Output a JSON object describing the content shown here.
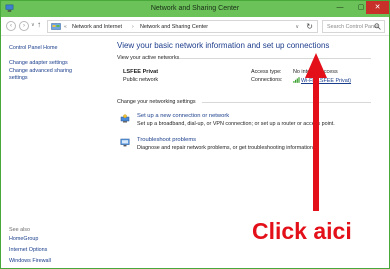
{
  "window": {
    "title": "Network and Sharing Center",
    "min_glyph": "—",
    "max_glyph": "▢",
    "close_glyph": "✕"
  },
  "address_bar": {
    "recent_glyph": "∨",
    "up_glyph": "↑",
    "path_sep0": "«",
    "crumbs": [
      "Network and Internet",
      "Network and Sharing Center"
    ],
    "crumb_sep": "›",
    "dropdown_glyph": "∨",
    "refresh_glyph": "↻",
    "search_placeholder": "Search Control Panel"
  },
  "sidebar": {
    "home": "Control Panel Home",
    "adapter": "Change adapter settings",
    "advanced": "Change advanced sharing settings",
    "see_also": "See also",
    "links": [
      "HomeGroup",
      "Internet Options",
      "Windows Firewall"
    ]
  },
  "main": {
    "heading": "View your basic network information and set up connections",
    "active_section": "View your active networks",
    "network": {
      "name": "LSFEE Privat",
      "type": "Public network",
      "access_label": "Access type:",
      "access_value": "No internet access",
      "connections_label": "Connections:",
      "connection_value": "Wi-Fi (LSFEE Privat)"
    },
    "change_section": "Change your networking settings",
    "tasks": [
      {
        "title": "Set up a new connection or network",
        "desc": "Set up a broadband, dial-up, or VPN connection; or set up a router or access point."
      },
      {
        "title": "Troubleshoot problems",
        "desc": "Diagnose and repair network problems, or get troubleshooting information."
      }
    ]
  },
  "annotation": {
    "text": "Click aici",
    "color": "#e3101a"
  },
  "colors": {
    "titlebar": "#6ac259",
    "close": "#c7312a",
    "link": "#1a3e8c"
  }
}
